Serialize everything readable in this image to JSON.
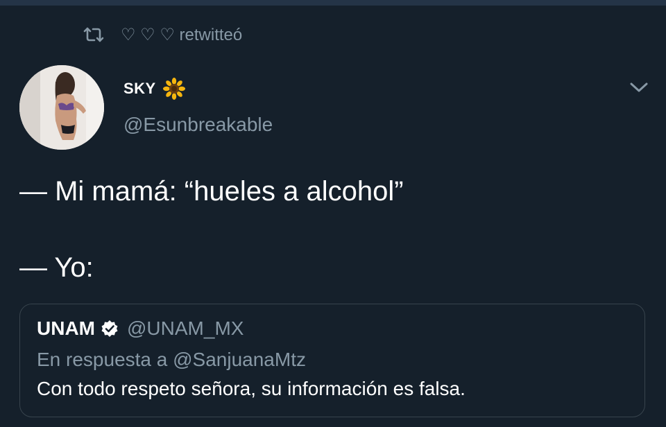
{
  "retweet": {
    "label": "♡ ♡ ♡ retwitteó"
  },
  "tweet": {
    "display_name": "SKY",
    "name_emoji": "sunflower-emoji",
    "handle": "@Esunbreakable",
    "lines": [
      "— Mi mamá: “hueles a alcohol”",
      "— Yo:"
    ]
  },
  "quoted_tweet": {
    "display_name": "UNAM",
    "verified": true,
    "handle": "@UNAM_MX",
    "reply_to": "En respuesta a @SanjuanaMtz",
    "text": "Con todo respeto señora, su información es falsa."
  },
  "colors": {
    "background": "#15202b",
    "secondary_text": "#8899a6",
    "border": "#38444d",
    "topbar": "#243447"
  },
  "icons": [
    "retweet-icon",
    "sunflower-emoji",
    "chevron-down-icon",
    "verified-badge-icon",
    "avatar"
  ]
}
